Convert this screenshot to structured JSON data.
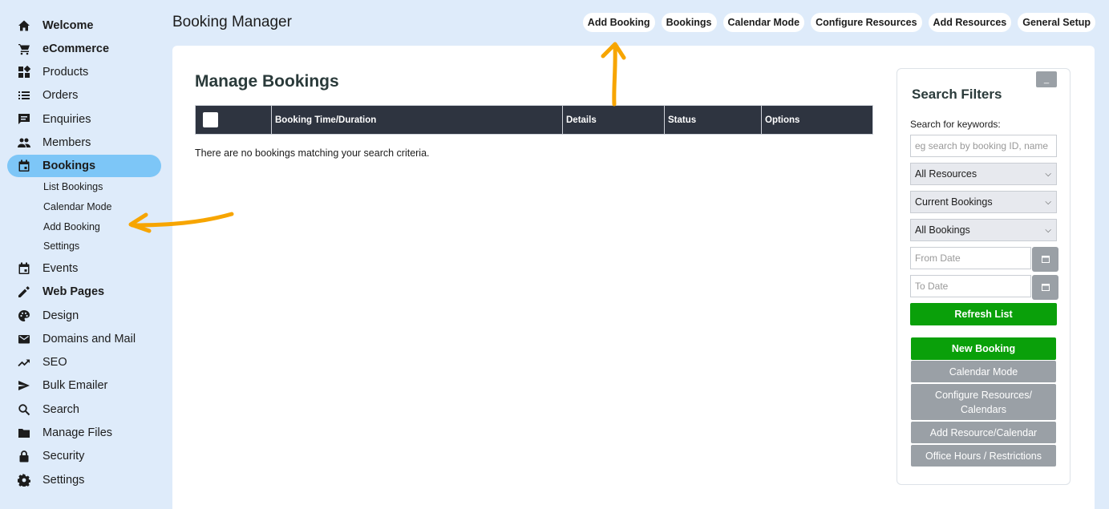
{
  "sidebar": {
    "items": [
      {
        "label": "Welcome",
        "icon": "home-icon"
      },
      {
        "label": "eCommerce",
        "icon": "cart-icon"
      },
      {
        "label": "Products",
        "icon": "grid-icon"
      },
      {
        "label": "Orders",
        "icon": "list-icon"
      },
      {
        "label": "Enquiries",
        "icon": "chat-icon"
      },
      {
        "label": "Members",
        "icon": "people-icon"
      },
      {
        "label": "Bookings",
        "icon": "calendar-icon"
      },
      {
        "label": "Events",
        "icon": "calendar-icon"
      },
      {
        "label": "Web Pages",
        "icon": "pencil-icon"
      },
      {
        "label": "Design",
        "icon": "palette-icon"
      },
      {
        "label": "Domains and Mail",
        "icon": "mail-icon"
      },
      {
        "label": "SEO",
        "icon": "trending-icon"
      },
      {
        "label": "Bulk Emailer",
        "icon": "send-icon"
      },
      {
        "label": "Search",
        "icon": "search-icon"
      },
      {
        "label": "Manage Files",
        "icon": "folder-icon"
      },
      {
        "label": "Security",
        "icon": "lock-icon"
      },
      {
        "label": "Settings",
        "icon": "gear-icon"
      }
    ],
    "bookings_sub": [
      "List Bookings",
      "Calendar Mode",
      "Add Booking",
      "Settings"
    ]
  },
  "header": {
    "title": "Booking Manager",
    "links": [
      "Add Booking",
      "Bookings",
      "Calendar Mode",
      "Configure Resources",
      "Add Resources",
      "General Setup"
    ]
  },
  "main": {
    "title": "Manage Bookings",
    "columns": [
      "Booking Time/Duration",
      "Details",
      "Status",
      "Options"
    ],
    "empty_message": "There are no bookings matching your search criteria."
  },
  "filters": {
    "collapse_label": "_",
    "title": "Search Filters",
    "keyword_label": "Search for keywords:",
    "keyword_placeholder": "eg search by booking ID, name",
    "resource_select": "All Resources",
    "period_select": "Current Bookings",
    "type_select": "All Bookings",
    "from_placeholder": "From Date",
    "to_placeholder": "To Date",
    "refresh_label": "Refresh List",
    "actions": {
      "new_booking": "New Booking",
      "calendar_mode": "Calendar Mode",
      "configure": "Configure Resources/ Calendars",
      "add_resource": "Add Resource/Calendar",
      "office_hours": "Office Hours / Restrictions"
    }
  },
  "colors": {
    "background": "#deebfa",
    "active_nav": "#7dc6f7",
    "table_header": "#2e3440",
    "green": "#0aa00a",
    "grey_button": "#9aa0a6",
    "annotation_arrow": "#f7a500"
  }
}
